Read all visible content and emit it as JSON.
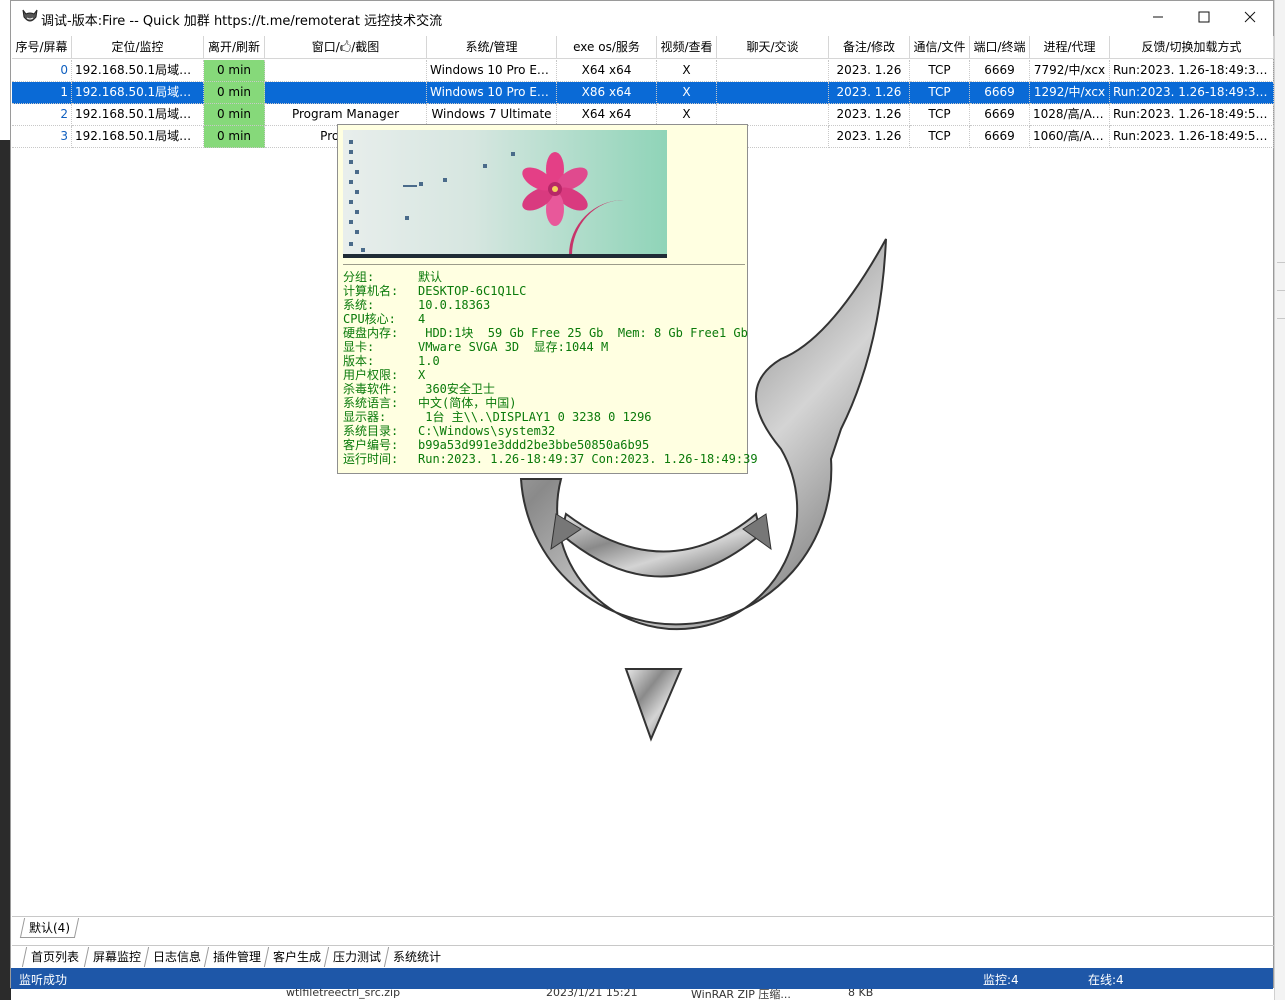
{
  "window": {
    "title": "调试-版本:Fire   -- Quick  加群 https://t.me/remoterat  远控技术交流"
  },
  "columns": [
    "序号/屏幕",
    "定位/监控",
    "离开/刷新",
    "窗口/🖒/截图",
    "系统/管理",
    "exe os/服务",
    "视频/查看",
    "聊天/交谈",
    "备注/修改",
    "通信/文件",
    "端口/终端",
    "进程/代理",
    "反馈/切换加载方式"
  ],
  "rows": [
    {
      "idx": "0",
      "loc": "192.168.50.1局域网 ...",
      "away": "0 min",
      "win": "",
      "sys": "Windows 10 Pro Ed...",
      "exe": "X64 x64",
      "video": "X",
      "chat": "",
      "note": "2023. 1.26",
      "comm": "TCP",
      "port": "6669",
      "proc": "7792/中/xcx",
      "fb": "Run:2023. 1.26-18:49:37 C..."
    },
    {
      "idx": "1",
      "loc": "192.168.50.1局域网 ...",
      "away": "0 min",
      "win": "",
      "sys": "Windows 10 Pro Ed...",
      "exe": "X86 x64",
      "video": "X",
      "chat": "",
      "note": "2023. 1.26",
      "comm": "TCP",
      "port": "6669",
      "proc": "1292/中/xcx",
      "fb": "Run:2023. 1.26-18:49:37 C..."
    },
    {
      "idx": "2",
      "loc": "192.168.50.1局域网 ...",
      "away": "0 min",
      "win": "Program Manager",
      "sys": "Windows 7 Ultimate",
      "exe": "X64 x64",
      "video": "X",
      "chat": "",
      "note": "2023. 1.26",
      "comm": "TCP",
      "port": "6669",
      "proc": "1028/高/Ad...",
      "fb": "Run:2023. 1.26-18:49:58 C..."
    },
    {
      "idx": "3",
      "loc": "192.168.50.1局域网 ...",
      "away": "0 min",
      "win": "Program",
      "sys": "",
      "exe": "",
      "video": "",
      "chat": "",
      "note": "2023. 1.26",
      "comm": "TCP",
      "port": "6669",
      "proc": "1060/高/Ad...",
      "fb": "Run:2023. 1.26-18:49:59 C..."
    }
  ],
  "tooltip": {
    "lines": [
      {
        "k": "分组:",
        "v": "默认"
      },
      {
        "k": "计算机名:",
        "v": "DESKTOP-6C1Q1LC"
      },
      {
        "k": "系统:",
        "v": "10.0.18363"
      },
      {
        "k": "CPU核心:",
        "v": "4"
      },
      {
        "k": "硬盘内存:",
        "v": " HDD:1块  59 Gb Free 25 Gb  Mem: 8 Gb Free1 Gb"
      },
      {
        "k": "显卡:",
        "v": "VMware SVGA 3D  显存:1044 M"
      },
      {
        "k": "版本:",
        "v": "1.0"
      },
      {
        "k": "用户权限:",
        "v": "X"
      },
      {
        "k": "杀毒软件:",
        "v": " 360安全卫士"
      },
      {
        "k": "系统语言:",
        "v": "中文(简体，中国)"
      },
      {
        "k": "显示器:",
        "v": " 1台 主\\\\.\\DISPLAY1 0 3238 0 1296"
      },
      {
        "k": "系统目录:",
        "v": "C:\\Windows\\system32"
      },
      {
        "k": "客户编号:",
        "v": "b99a53d991e3ddd2be3bbe50850a6b95"
      },
      {
        "k": "运行时间:",
        "v": "Run:2023. 1.26-18:49:37 Con:2023. 1.26-18:49:39"
      }
    ]
  },
  "group_tab": "默认(4)",
  "bottom_tabs": [
    "首页列表",
    "屏幕监控",
    "日志信息",
    "插件管理",
    "客户生成",
    "压力测试",
    "系统统计"
  ],
  "status": {
    "left": "监听成功",
    "monitor": "监控:4",
    "online": "在线:4"
  },
  "behind": {
    "file": "wtlfiletreectrl_src.zip",
    "date": "2023/1/21 15:21",
    "type": "WinRAR ZIP 压缩...",
    "size": "8 KB"
  },
  "colors": {
    "selected": "#0a6ad6",
    "away_green": "#86d97a",
    "tooltip_bg": "#ffffe1",
    "tooltip_text": "#0a7a0a",
    "statusbar": "#1e57a8"
  }
}
